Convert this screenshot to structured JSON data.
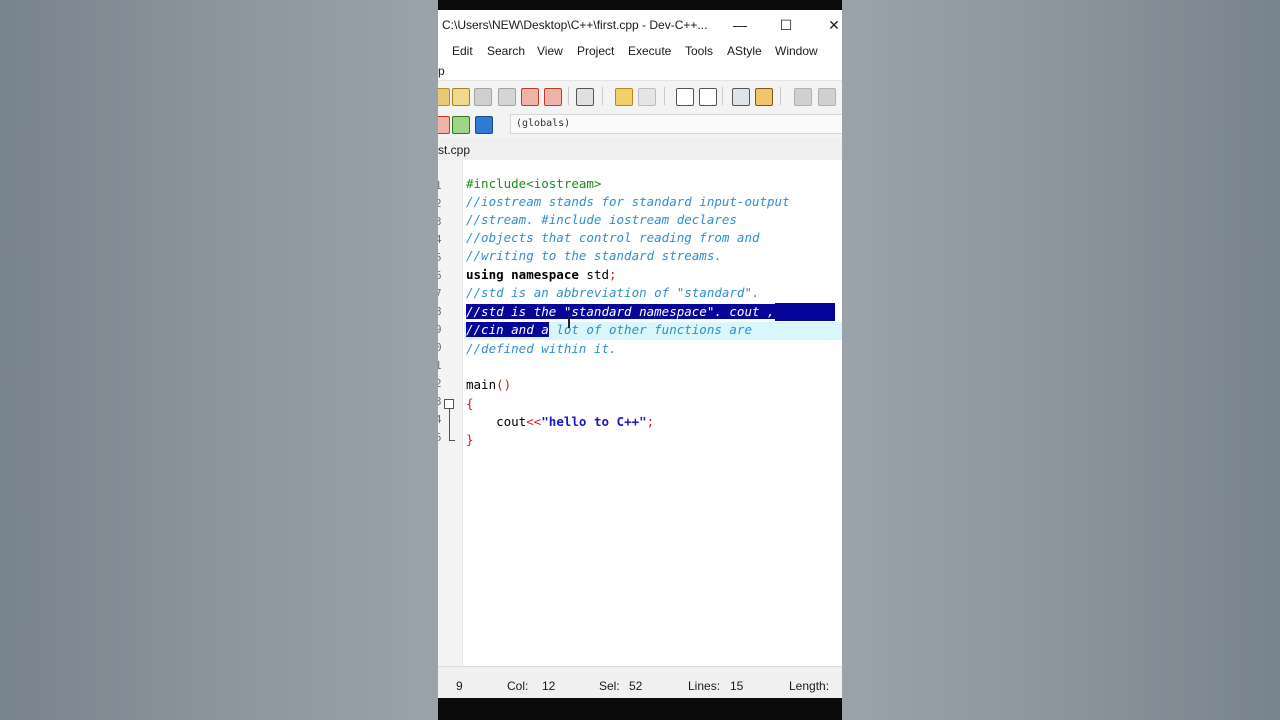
{
  "window": {
    "title": "C:\\Users\\NEW\\Desktop\\C++\\first.cpp - Dev-C++...",
    "minimize": "—",
    "maximize": "☐",
    "close": "✕"
  },
  "menu": [
    "Edit",
    "Search",
    "View",
    "Project",
    "Execute",
    "Tools",
    "AStyle",
    "Window"
  ],
  "menu_row2": "p",
  "toolbar": {
    "scope_value": "(globals)"
  },
  "tab": {
    "label": "st.cpp"
  },
  "gutter_numbers": [
    "1",
    "2",
    "3",
    "4",
    "5",
    "6",
    "7",
    "8",
    "9",
    "0",
    "1",
    "2",
    "3",
    "4",
    "5"
  ],
  "code": {
    "l1": "#include<iostream>",
    "l2": "//iostream stands for standard input-output",
    "l3": "//stream. #include iostream declares",
    "l4": "//objects that control reading from and",
    "l5": "//writing to the standard streams.",
    "l6_kw": "using namespace",
    "l6_rest": " std",
    "l6_semi": ";",
    "l7": "//std is an abbreviation of \"standard\".",
    "l8_a": "//s",
    "l8_sel": "td is the \"standard namespace\". cout ,",
    "l9_sel": "//cin and a",
    "l9_rest": " lot of other functions are",
    "l10": "//defined within it.",
    "l12_fn": "main",
    "l12_paren": "()",
    "l13": "{",
    "l14_a": "    cout",
    "l14_op": "<<",
    "l14_str": "\"hello to C++\"",
    "l14_semi": ";",
    "l15": "}"
  },
  "status": {
    "line": "9",
    "col_label": "Col:",
    "col_value": "12",
    "sel_label": "Sel:",
    "sel_value": "52",
    "lines_label": "Lines:",
    "lines_value": "15",
    "length_label": "Length:"
  },
  "colors": {
    "comment": "#2f8fd0",
    "preprocessor": "#1d8a1d",
    "selection": "#05059a",
    "current_line": "#d9f6fb",
    "string": "#1717c8"
  }
}
